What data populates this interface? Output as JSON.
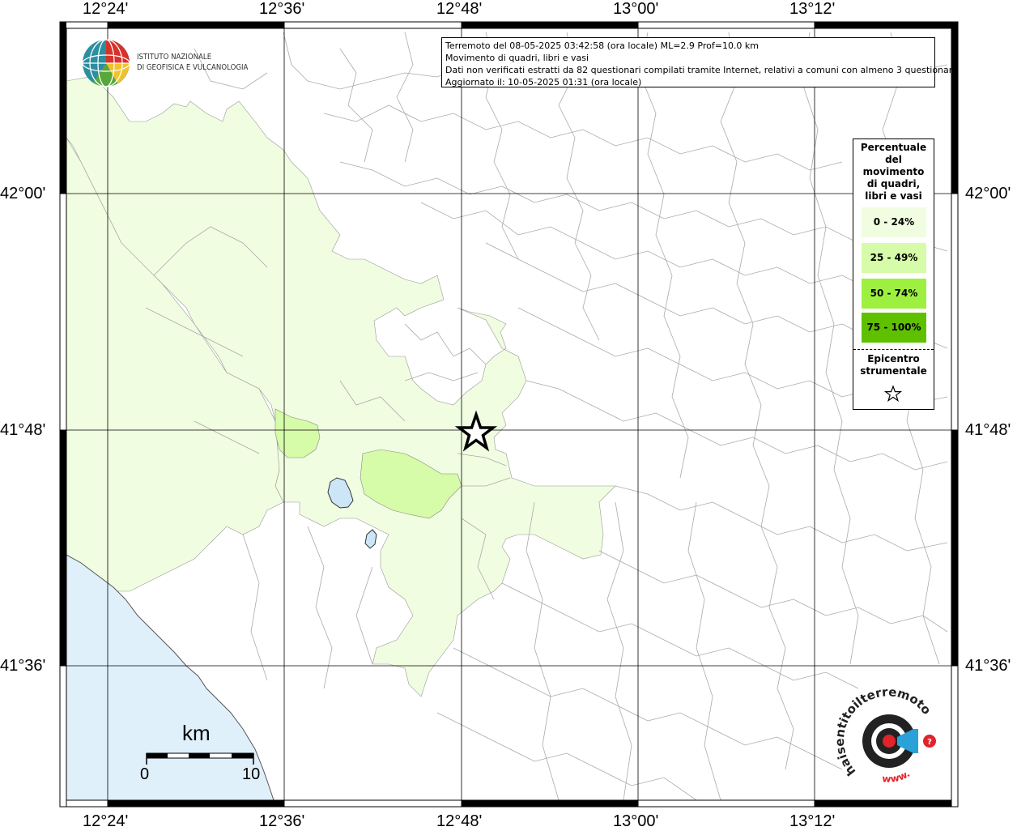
{
  "info": {
    "line1": "Terremoto del 08-05-2025 03:42:58 (ora locale) ML=2.9 Prof=10.0 km",
    "line2": "Movimento di quadri, libri e vasi",
    "line3": "Dati non verificati estratti da 82 questionari compilati tramite Internet, relativi a comuni con almeno 3 questionari.",
    "line4": "Aggiornato il: 10-05-2025 01:31 (ora locale)"
  },
  "logo": {
    "line1": "ISTITUTO NAZIONALE",
    "line2": "DI GEOFISICA E VULCANOLOGIA"
  },
  "axes": {
    "top": [
      "12°24'",
      "12°36'",
      "12°48'",
      "13°00'",
      "13°12'"
    ],
    "bottom": [
      "12°24'",
      "12°36'",
      "12°48'",
      "13°00'",
      "13°12'"
    ],
    "left": [
      "42°00'",
      "41°48'",
      "41°36'"
    ],
    "right": [
      "42°00'",
      "41°48'",
      "41°36'"
    ]
  },
  "legend": {
    "title_lines": [
      "Percentuale",
      "del",
      "movimento",
      "di quadri,",
      "libri e vasi"
    ],
    "classes": [
      {
        "label": "0 - 24%",
        "color": "#f0fde0"
      },
      {
        "label": "25 - 49%",
        "color": "#d6fba9"
      },
      {
        "label": "50 - 74%",
        "color": "#9ef040"
      },
      {
        "label": "75 - 100%",
        "color": "#5fc000"
      }
    ],
    "epicenter_lines": [
      "Epicentro",
      "strumentale"
    ],
    "epicenter_icon": "star-icon"
  },
  "scale": {
    "unit": "km",
    "start": "0",
    "end": "10"
  },
  "badge": {
    "text": "haisentitoilterremoto.it",
    "suffix": "www.",
    "icon": "megaphone-icon"
  },
  "colors": {
    "sea": "#dff0fb",
    "lake": "#cde6f7",
    "class_0_24": "#f0fde0",
    "class_25_49": "#d6fba9"
  }
}
